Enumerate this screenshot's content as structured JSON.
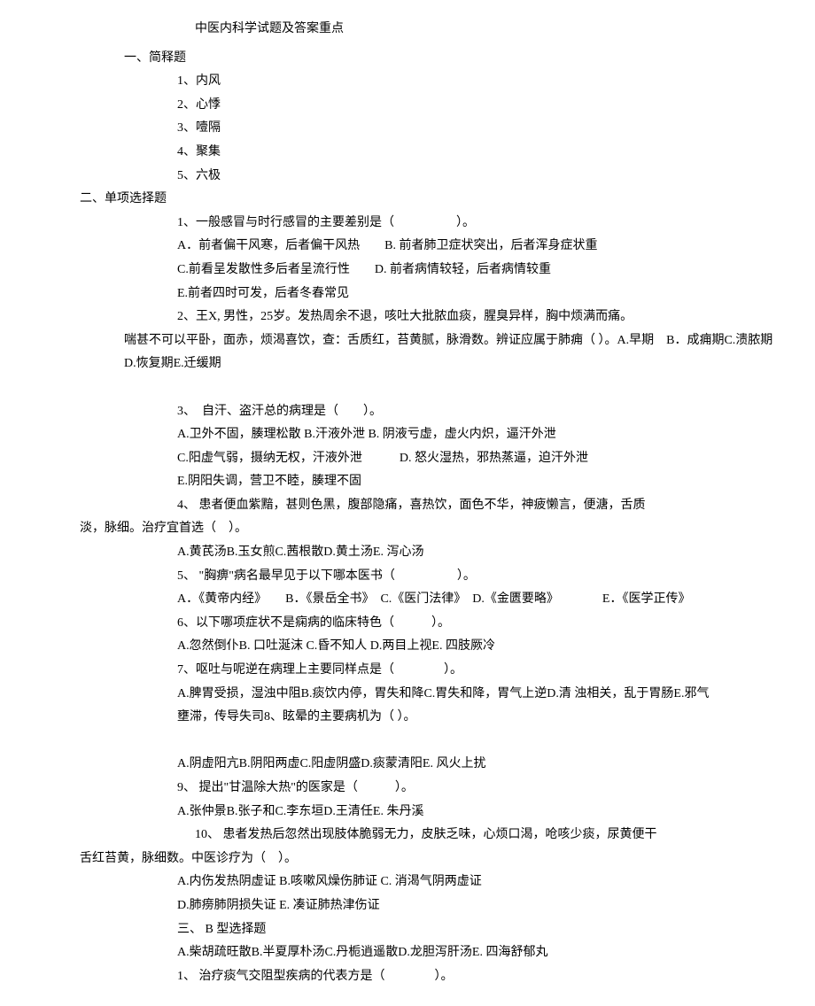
{
  "title": "中医内科学试题及答案重点",
  "sec1": {
    "heading": "一、简释题",
    "items": [
      "1、内风",
      "2、心悸",
      "3、噎隔",
      "4、聚集",
      "5、六极"
    ]
  },
  "sec2": {
    "heading": "二、单项选择题",
    "q1": "1、一般感冒与时行感冒的主要差别是（　　　　　）。",
    "q1a": "A．前者偏干风寒，后者偏干风热　　B. 前者肺卫症状突出，后者浑身症状重",
    "q1b": "C.前看呈发散性多后者呈流行性　　D. 前者病情较轻，后者病情较重",
    "q1c": "E.前者四时可发，后者冬春常见",
    "q2": "2、王X, 男性，25岁。发热周余不退，咳吐大批脓血痰，腥臭异样，胸中烦满而痛。",
    "q2b": "喘甚不可以平卧，面赤，烦渴喜饮，查：舌质红，苔黄腻，脉滑数。辨证应属于肺痈（ ）。A.早期　B．成痈期C.溃脓期D.恢复期E.迁缓期",
    "q3": "3、　自汗、盗汗总的病理是（　　）。",
    "q3a": "A.卫外不固，腠理松散  B.汗液外泄  B. 阴液亏虚，虚火内炽，逼汗外泄",
    "q3b": "C.阳虚气弱，摄纳无权，汗液外泄　　　D. 怒火湿热，邪热蒸逼，迫汗外泄",
    "q3c": "E.阴阳失调，营卫不睦，腠理不固",
    "q4": "4、 患者便血紫黯，甚则色黑，腹部隐痛，喜热饮，面色不华，神疲懒言，便溏，舌质",
    "q4b": "淡，脉细。治疗宜首选（　）。",
    "q4c": "A.黄芪汤B.玉女煎C.茜根散D.黄土汤E. 泻心汤",
    "q5": "5、 \"胸痹\"病名最早见于以下哪本医书（　　　　　）。",
    "q5a": "A．《黄帝内经》　　B．《景岳全书》　C.《医门法律》　D.《金匮要略》　　　　E．《医学正传》",
    "q6": "6、以下哪项症状不是痫病的临床特色（　　　）。",
    "q6a": "A.忽然倒仆B. 口吐涎沫  C.昏不知人  D.两目上视E. 四肢厥冷",
    "q7": "7、呕吐与呢逆在病理上主要同样点是（　　　　）。",
    "q7a": "A.脾胃受损，湿浊中阻B.痰饮内停，胃失和降C.胃失和降，胃气上逆D.清 浊相关，乱于胃肠E.邪气",
    "q7b": "壅滞，传导失司8、眩晕的主要病机为（ ）。",
    "q8a": "A.阴虚阳亢B.阴阳两虚C.阳虚阴盛D.痰蒙清阳E. 风火上扰",
    "q9": "9、 提出\"甘温除大热\"的医家是（　　　）。",
    "q9a": "A.张仲景B.张子和C.李东垣D.王清任E. 朱丹溪",
    "q10": "10、 患者发热后忽然出现肢体脆弱无力，皮肤乏味，心烦口渴，呛咳少痰，尿黄便干",
    "q10b": "舌红苔黄，脉细数。中医诊疗为（　）。",
    "q10c": "A.内伤发热阴虚证  B.咳嗽风燥伤肺证  C. 消渴气阴两虚证",
    "q10d": "D.肺痨肺阴损失证  E. 凑证肺热津伤证"
  },
  "sec3": {
    "heading": "三、 B  型选择题",
    "opts": "A.柴胡疏旺散B.半夏厚朴汤C.丹栀逍遥散D.龙胆泻肝汤E. 四海舒郁丸",
    "q1": "1、 治疗痰气交阻型疾病的代表方是（　　　　）。"
  }
}
